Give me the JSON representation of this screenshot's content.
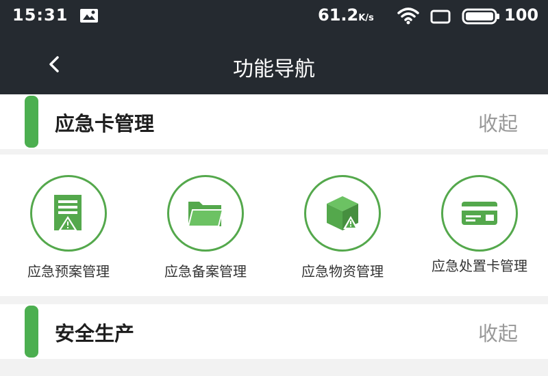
{
  "status_bar": {
    "time": "15:31",
    "network_speed": "61.2",
    "speed_unit": "K/s",
    "battery": "100"
  },
  "nav": {
    "title": "功能导航",
    "back_icon": "chevron-left-icon"
  },
  "sections": [
    {
      "title": "应急卡管理",
      "action": "收起",
      "items": [
        {
          "label": "应急预案管理",
          "icon": "document-warning-icon"
        },
        {
          "label": "应急备案管理",
          "icon": "folder-icon"
        },
        {
          "label": "应急物资管理",
          "icon": "box-warning-icon"
        },
        {
          "label": "应急处置卡管理",
          "icon": "card-icon"
        }
      ]
    },
    {
      "title": "安全生产",
      "action": "收起"
    }
  ],
  "colors": {
    "header_bg": "#252a30",
    "accent_green": "#4caf50",
    "icon_green": "#54a84c",
    "muted_text": "#999999"
  }
}
